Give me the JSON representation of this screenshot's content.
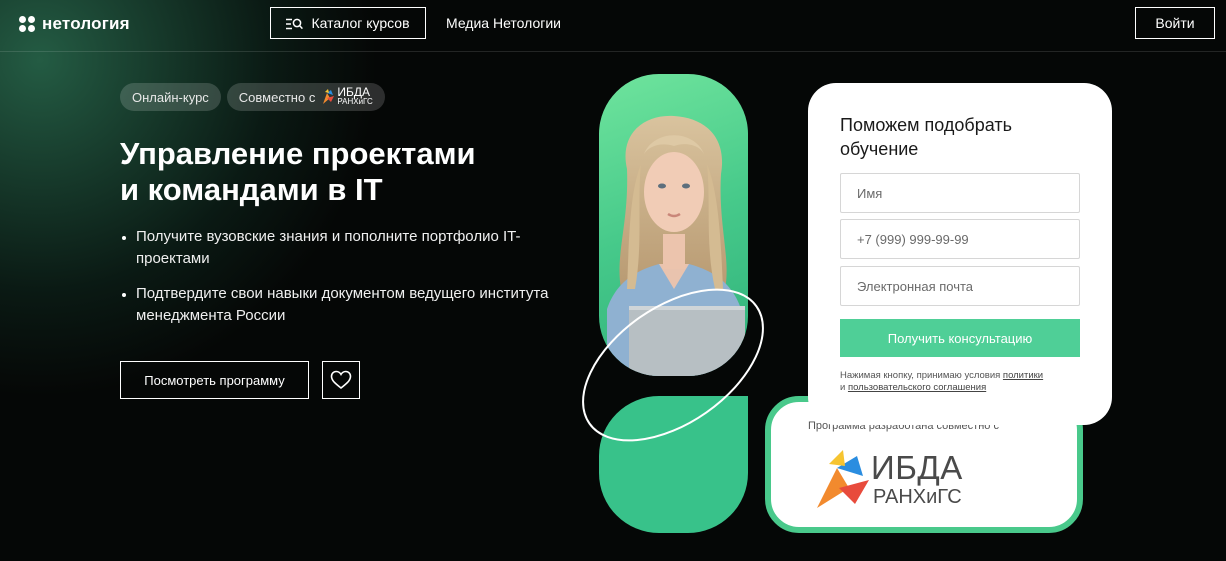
{
  "header": {
    "logo_text": "нетология",
    "catalog_label": "Каталог курсов",
    "media_label": "Медиа Нетологии",
    "login_label": "Войти"
  },
  "hero": {
    "tag_format": "Онлайн-курс",
    "tag_partner_prefix": "Совместно с",
    "tag_partner_logo_top": "ИБДА",
    "tag_partner_logo_bottom": "РАНХиГС",
    "title_line1": "Управление проектами",
    "title_line2": "и командами в IT",
    "bullets": [
      "Получите вузовские знания и пополните портфолио IT-проектами",
      "Подтвердите свои навыки документом ведущего института менеджмента России"
    ],
    "program_button": "Посмотреть программу",
    "favorite_icon": "heart-icon"
  },
  "form": {
    "title": "Поможем подобрать обучение",
    "name_placeholder": "Имя",
    "phone_placeholder": "+7 (999) 999-99-99",
    "email_placeholder": "Электронная почта",
    "submit_label": "Получить консультацию",
    "consent_text": "Нажимая кнопку, принимаю условия",
    "consent_link1": "политики",
    "consent_and": "и",
    "consent_link2": "пользовательского соглашения"
  },
  "partner": {
    "caption": "Программа разработана совместно с",
    "logo_line1": "ИБДА",
    "logo_line2": "РАНХиГС"
  },
  "colors": {
    "accent_green": "#4fcf97",
    "background": "#050706"
  }
}
